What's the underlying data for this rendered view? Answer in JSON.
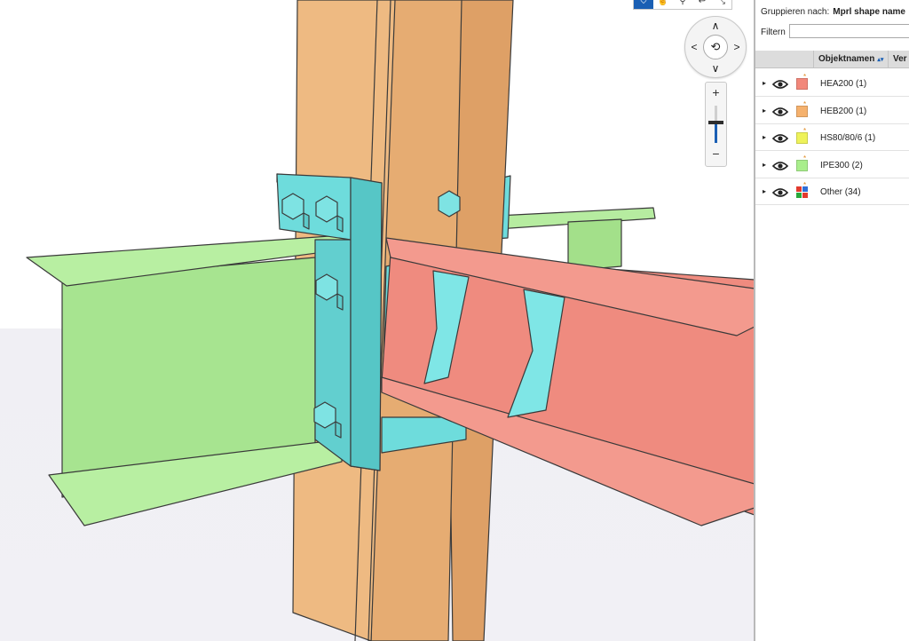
{
  "toolbar": {
    "buttons": [
      {
        "icon": "select-cursor-icon",
        "glyph": "⛉",
        "active": true
      },
      {
        "icon": "orbit-hand-icon",
        "glyph": "☝",
        "active": false
      },
      {
        "icon": "section-tool-icon",
        "glyph": "⚲",
        "active": false
      },
      {
        "icon": "undo-arrow-icon",
        "glyph": "↩",
        "active": false
      },
      {
        "icon": "collapse-icon",
        "glyph": "⤡",
        "active": false
      }
    ]
  },
  "navigation": {
    "up": "∧",
    "down": "∨",
    "left": "<",
    "right": ">",
    "center": "⟲"
  },
  "zoom": {
    "plus": "+",
    "minus": "−",
    "level": 0.45
  },
  "panel": {
    "group_label": "Gruppieren nach:",
    "group_value": "Mprl shape name",
    "filter_label": "Filtern",
    "filter_value": "",
    "columns": [
      "Objektnamen",
      "Ver"
    ],
    "sort_indicator": "▴▾",
    "rows": [
      {
        "label": "HEA200 (1)",
        "color": "#f2877a"
      },
      {
        "label": "HEB200 (1)",
        "color": "#f5b16d"
      },
      {
        "label": "HS80/80/6 (1)",
        "color": "#eef25a"
      },
      {
        "label": "IPE300 (2)",
        "color": "#a9ee8c"
      },
      {
        "label": "Other (34)",
        "colors": [
          "#e23a2e",
          "#2f6fd8",
          "#29a83a",
          "#e23a2e"
        ]
      }
    ],
    "expand_glyph": "▸",
    "star_glyph": "*"
  },
  "colors": {
    "accent": "#1a5fb4",
    "column_orange": "#e8b47c",
    "plate_cyan": "#6edcdc",
    "beam_red": "#ef8b7f",
    "beam_green": "#aee89a"
  }
}
